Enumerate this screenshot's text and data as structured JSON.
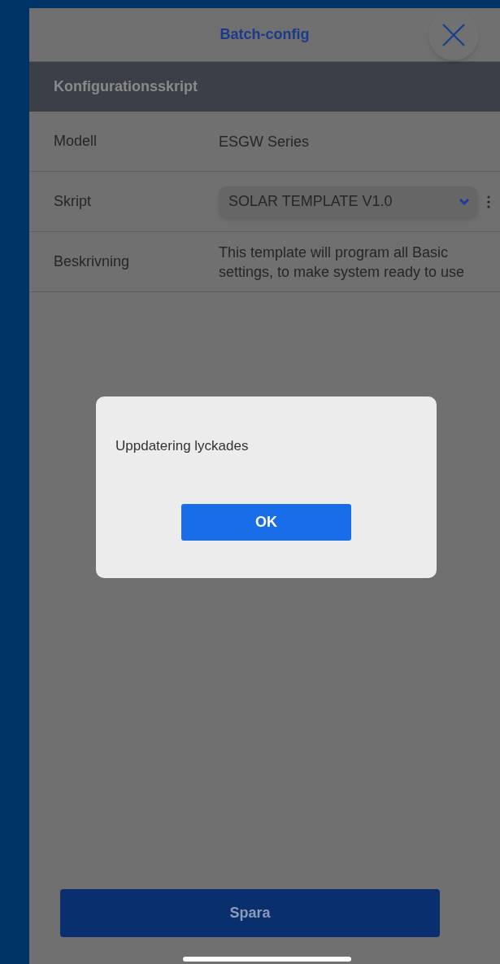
{
  "header": {
    "title": "Batch-config"
  },
  "section": {
    "title": "Konfigurationsskript"
  },
  "rows": [
    {
      "kind": "text",
      "label": "Modell",
      "value": "ESGW Series"
    },
    {
      "kind": "select",
      "label": "Skript",
      "value": "SOLAR TEMPLATE V1.0"
    },
    {
      "kind": "text",
      "label": "Beskrivning",
      "value": "This template will program all Basic settings, to make system ready to use"
    }
  ],
  "dialog": {
    "message": "Uppdatering lyckades",
    "button": "OK"
  },
  "save_button": "Spara"
}
